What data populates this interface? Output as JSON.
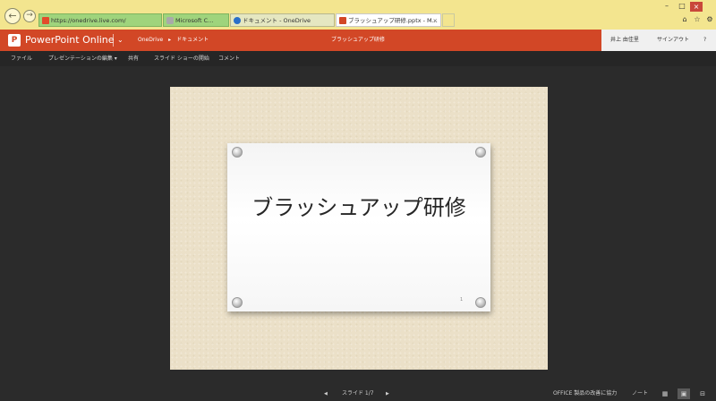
{
  "browser": {
    "address": "https://onedrive.live.com/",
    "tabs": [
      {
        "label": "Microsoft C...",
        "icon": "lock-icon"
      },
      {
        "label": "ドキュメント - OneDrive",
        "icon": "cloud-icon"
      },
      {
        "label": "ブラッシュアップ研修.pptx - M...",
        "icon": "powerpoint-icon"
      }
    ]
  },
  "app": {
    "brand": "PowerPoint Online",
    "breadcrumb": [
      "OneDrive",
      "▸",
      "ドキュメント"
    ],
    "doc_title": "ブラッシュアップ研修",
    "user": "井上 由佳里",
    "signout": "サインアウト",
    "help": "?"
  },
  "menu": [
    "ファイル",
    "プレゼンテーションの編集 ▾",
    "共有",
    "スライド ショーの開始",
    "コメント"
  ],
  "slide": {
    "title": "ブラッシュアップ研修",
    "number": "1"
  },
  "status": {
    "prev": "◀",
    "slide_counter": "スライド 1/7",
    "next": "▶",
    "improve": "OFFICE 製品の改善に協力",
    "notes": "ノート"
  },
  "colors": {
    "chrome": "#f3e58f",
    "brand": "#d24726",
    "slide_bg": "#ebe0c8"
  }
}
